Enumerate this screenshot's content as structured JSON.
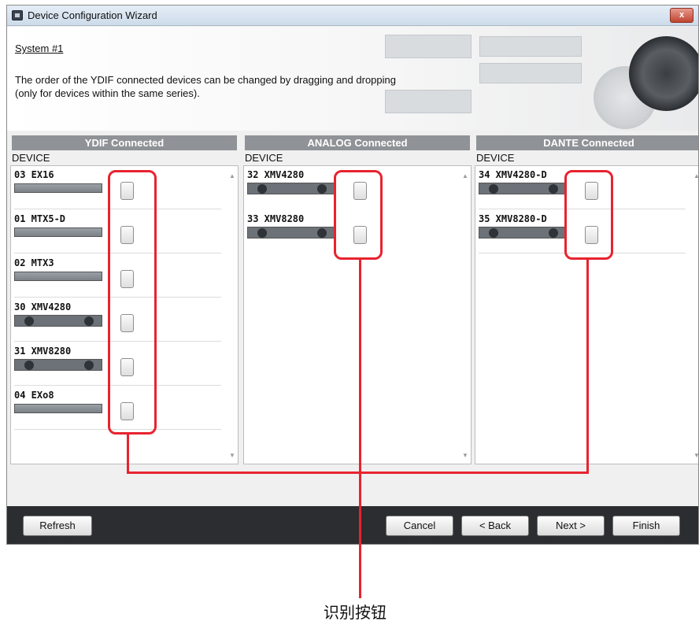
{
  "window": {
    "title": "Device Configuration Wizard",
    "close_label": "x",
    "icon": "app-icon"
  },
  "header": {
    "system_title": "System #1",
    "description_line1": "The order of the YDIF connected devices can be changed by dragging and dropping",
    "description_line2": "(only for devices within the same series)."
  },
  "columns": {
    "ydif": {
      "title": "YDIF Connected",
      "subheader": "DEVICE",
      "devices": [
        {
          "name": "03 EX16"
        },
        {
          "name": "01 MTX5-D"
        },
        {
          "name": "02 MTX3"
        },
        {
          "name": "30 XMV4280"
        },
        {
          "name": "31 XMV8280"
        },
        {
          "name": "04 EXo8"
        }
      ]
    },
    "analog": {
      "title": "ANALOG Connected",
      "subheader": "DEVICE",
      "devices": [
        {
          "name": "32 XMV4280"
        },
        {
          "name": "33 XMV8280"
        }
      ]
    },
    "dante": {
      "title": "DANTE Connected",
      "subheader": "DEVICE",
      "devices": [
        {
          "name": "34 XMV4280-D"
        },
        {
          "name": "35 XMV8280-D"
        }
      ]
    }
  },
  "footer": {
    "refresh_label": "Refresh",
    "cancel_label": "Cancel",
    "back_label": "< Back",
    "next_label": "Next >",
    "finish_label": "Finish"
  },
  "annotation": {
    "callout_label": "识别按钮",
    "highlight_color": "#e8232f"
  }
}
